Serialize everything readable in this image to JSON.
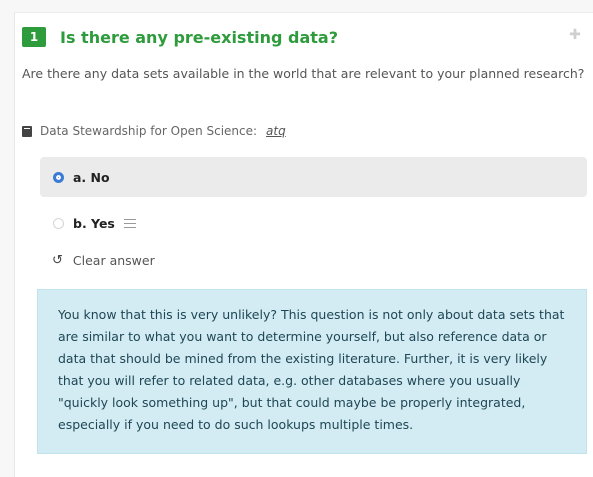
{
  "question": {
    "number": "1",
    "title": "Is there any pre-existing data?",
    "description": "Are there any data sets available in the world that are relevant to your planned research?"
  },
  "resource": {
    "label": "Data Stewardship for Open Science:",
    "link": "atq"
  },
  "options": [
    {
      "label": "a. No",
      "selected": true
    },
    {
      "label": "b. Yes",
      "selected": false
    }
  ],
  "clear_answer": "Clear answer",
  "info": "You know that this is very unlikely? This question is not only about data sets that are similar to what you want to determine yourself, but also reference data or data that should be mined from the existing literature. Further, it is very likely that you will refer to related data, e.g. other databases where you usually \"quickly look something up\", but that could maybe be properly integrated, especially if you need to do such lookups multiple times.",
  "colors": {
    "accent_green": "#2e9b3c",
    "radio_blue": "#3a7bd5",
    "info_bg": "#d3ecf3"
  },
  "icons": [
    "plus-icon",
    "book-icon",
    "list-icon",
    "undo-icon"
  ]
}
